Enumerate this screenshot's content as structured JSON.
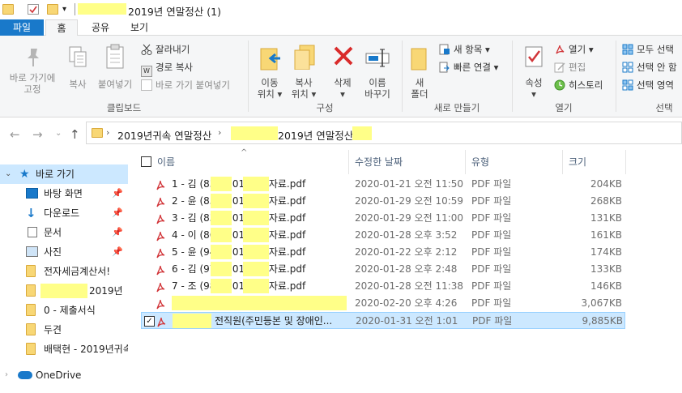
{
  "window": {
    "title": "2019년 연말정산 (1)"
  },
  "ribbon_tabs": [
    "파일",
    "홈",
    "공유",
    "보기"
  ],
  "ribbon": {
    "clipboard": {
      "pin_label_1": "바로 가기에",
      "pin_label_2": "고정",
      "copy": "복사",
      "paste": "붙여넣기",
      "cut": "잘라내기",
      "copy_path": "경로 복사",
      "paste_shortcut": "바로 가기 붙여넣기",
      "group": "클립보드"
    },
    "organize": {
      "move_1": "이동",
      "move_2": "위치",
      "copy_1": "복사",
      "copy_2": "위치",
      "delete": "삭제",
      "rename_1": "이름",
      "rename_2": "바꾸기",
      "group": "구성"
    },
    "new": {
      "new_folder_1": "새",
      "new_folder_2": "폴더",
      "new_item": "새 항목",
      "easy_access": "빠른 연결",
      "group": "새로 만들기"
    },
    "open": {
      "properties": "속성",
      "open": "열기",
      "edit": "편집",
      "history": "히스토리",
      "group": "열기"
    },
    "select": {
      "select_all": "모두 선택",
      "select_none": "선택 안 함",
      "invert": "선택 영역",
      "group": "선택"
    }
  },
  "address": {
    "crumb1": "2019년귀속 연말정산",
    "crumb2": "2019년 연말정산"
  },
  "nav": {
    "quick_access": "바로 가기",
    "items": [
      {
        "label": "바탕 화면",
        "icon": "desktop-icon",
        "pinned": true
      },
      {
        "label": "다운로드",
        "icon": "download-icon",
        "pinned": true
      },
      {
        "label": "문서",
        "icon": "document-icon",
        "pinned": true
      },
      {
        "label": "사진",
        "icon": "pictures-icon",
        "pinned": true
      },
      {
        "label": "전자세금계산서!",
        "icon": "folder-icon",
        "pinned": false
      },
      {
        "label": "2019년",
        "icon": "folder-icon",
        "pinned": false
      },
      {
        "label": "0 - 제출서식",
        "icon": "folder-icon",
        "pinned": false
      },
      {
        "label": "두견",
        "icon": "folder-icon",
        "pinned": false
      },
      {
        "label": "배택현 - 2019년귀속",
        "icon": "folder-icon",
        "pinned": false
      }
    ],
    "onedrive": "OneDrive"
  },
  "columns": {
    "name": "이름",
    "modified": "수정한 날짜",
    "type": "유형",
    "size": "크기"
  },
  "files": [
    {
      "name": "1 - 김    (83    )-2019년도자료.pdf",
      "date": "2020-01-21 오전 11:50",
      "type": "PDF 파일",
      "size": "204KB"
    },
    {
      "name": "2 - 윤    (85    )-2019년도자료.pdf",
      "date": "2020-01-29 오전 10:59",
      "type": "PDF 파일",
      "size": "268KB"
    },
    {
      "name": "3 - 김    (83    )-2019년도자료.pdf",
      "date": "2020-01-29 오전 11:00",
      "type": "PDF 파일",
      "size": "131KB"
    },
    {
      "name": "4 - 이    (86    )-2019년도자료.pdf",
      "date": "2020-01-28 오후 3:52",
      "type": "PDF 파일",
      "size": "161KB"
    },
    {
      "name": "5 - 윤    (94    )-2019년도자료.pdf",
      "date": "2020-01-22 오후 2:12",
      "type": "PDF 파일",
      "size": "174KB"
    },
    {
      "name": "6 - 김    (97    )-2019년도자료.pdf",
      "date": "2020-01-28 오후 2:48",
      "type": "PDF 파일",
      "size": "133KB"
    },
    {
      "name": "7 - 조    (98    )-2019년도자료.pdf",
      "date": "2020-01-28 오전 11:38",
      "type": "PDF 파일",
      "size": "146KB"
    },
    {
      "name": "",
      "date": "2020-02-20 오후 4:26",
      "type": "PDF 파일",
      "size": "3,067KB"
    },
    {
      "name": "전직원(주민등본 및 장애인...",
      "date": "2020-01-31 오전 1:01",
      "type": "PDF 파일",
      "size": "9,885KB"
    }
  ]
}
